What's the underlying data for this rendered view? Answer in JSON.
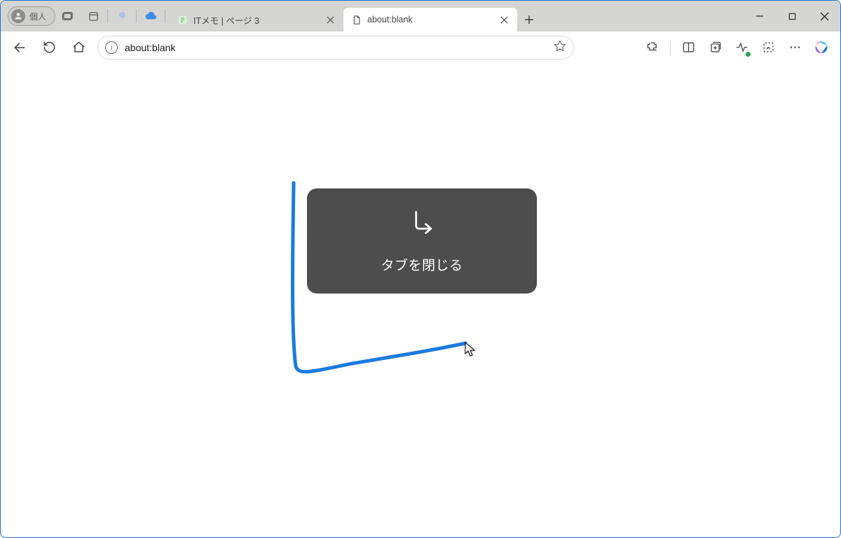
{
  "profile": {
    "label": "個人"
  },
  "tabs": [
    {
      "title": "ITメモ | ページ 3",
      "active": false
    },
    {
      "title": "about:blank",
      "active": true
    }
  ],
  "address": {
    "url": "about:blank"
  },
  "gesture": {
    "label": "タブを閉じる"
  },
  "colors": {
    "gesture_stroke": "#1a7ae0",
    "popup_bg": "#4d4d4d"
  }
}
